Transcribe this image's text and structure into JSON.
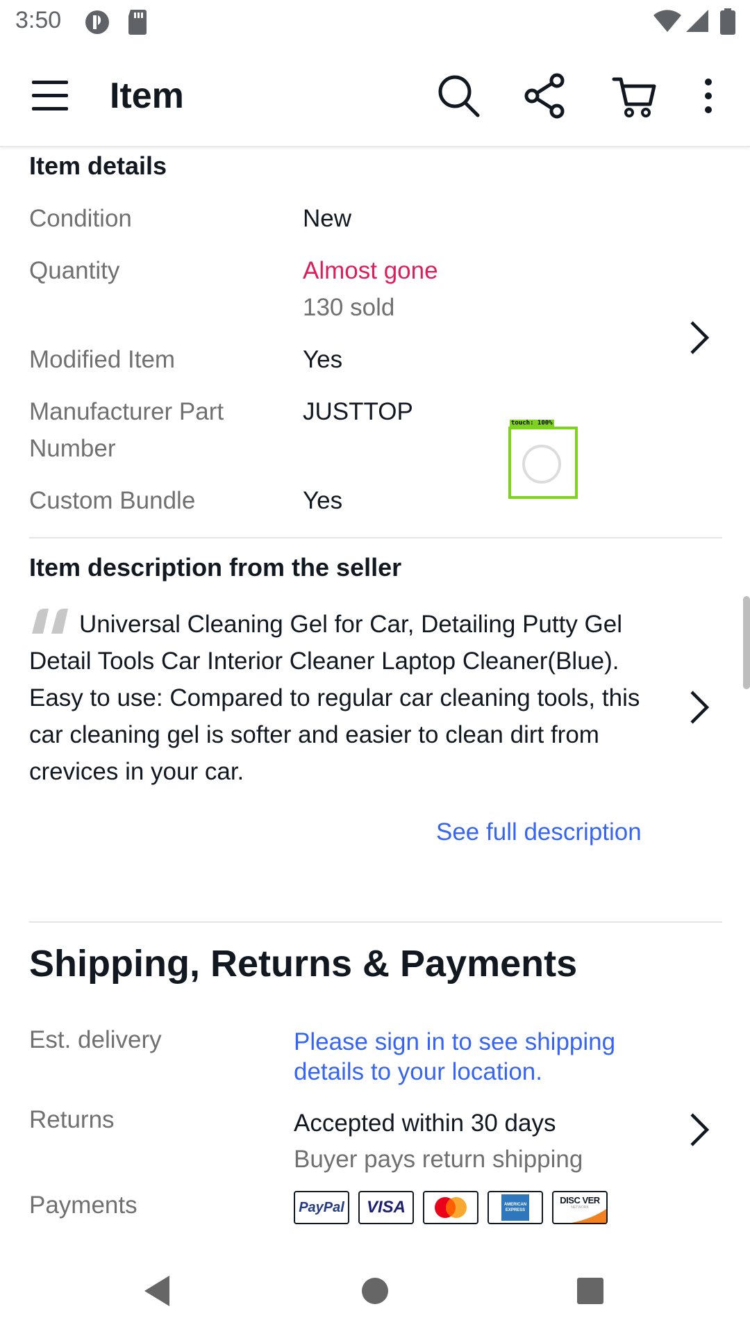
{
  "status_bar": {
    "time": "3:50"
  },
  "app_bar": {
    "title": "Item"
  },
  "item_details": {
    "title": "Item details",
    "rows": [
      {
        "label": "Condition",
        "value": "New"
      },
      {
        "label": "Quantity",
        "value": "Almost gone",
        "subvalue": "130 sold"
      },
      {
        "label": "Modified Item",
        "value": "Yes"
      },
      {
        "label_line1": "Manufacturer Part",
        "label_line2": "Number",
        "value": "JUSTTOP"
      },
      {
        "label": "Custom Bundle",
        "value": "Yes"
      }
    ]
  },
  "description": {
    "title": "Item description from the seller",
    "lines": [
      "Universal Cleaning Gel for Car, Detailing Putty Gel",
      "Detail Tools Car Interior Cleaner Laptop Cleaner(Blue).",
      "Easy to use: Compared to regular car cleaning tools, this",
      "car cleaning gel is softer and easier to clean dirt from",
      "crevices in your car."
    ],
    "see_full": "See full description"
  },
  "shipping": {
    "title": "Shipping, Returns & Payments",
    "est_delivery_label": "Est. delivery",
    "est_delivery_line1": "Please sign in to see shipping",
    "est_delivery_line2": "details to your location.",
    "returns_label": "Returns",
    "returns_value": "Accepted within 30 days",
    "returns_sub": "Buyer pays return shipping",
    "payments_label": "Payments",
    "payment_methods": {
      "paypal": "PayPal",
      "visa": "VISA",
      "mastercard": "",
      "amex_line1": "AMERICAN",
      "amex_line2": "EXPRESS",
      "discover": "DISC VER",
      "discover_sub": "NETWORK"
    }
  },
  "overlay": {
    "touch_label": "touch: 100%"
  },
  "colors": {
    "accent_link": "#3665f3",
    "urgent": "#dd1e5b",
    "text_primary": "#111820",
    "text_secondary": "#707070",
    "touch_box": "#7ed321"
  }
}
